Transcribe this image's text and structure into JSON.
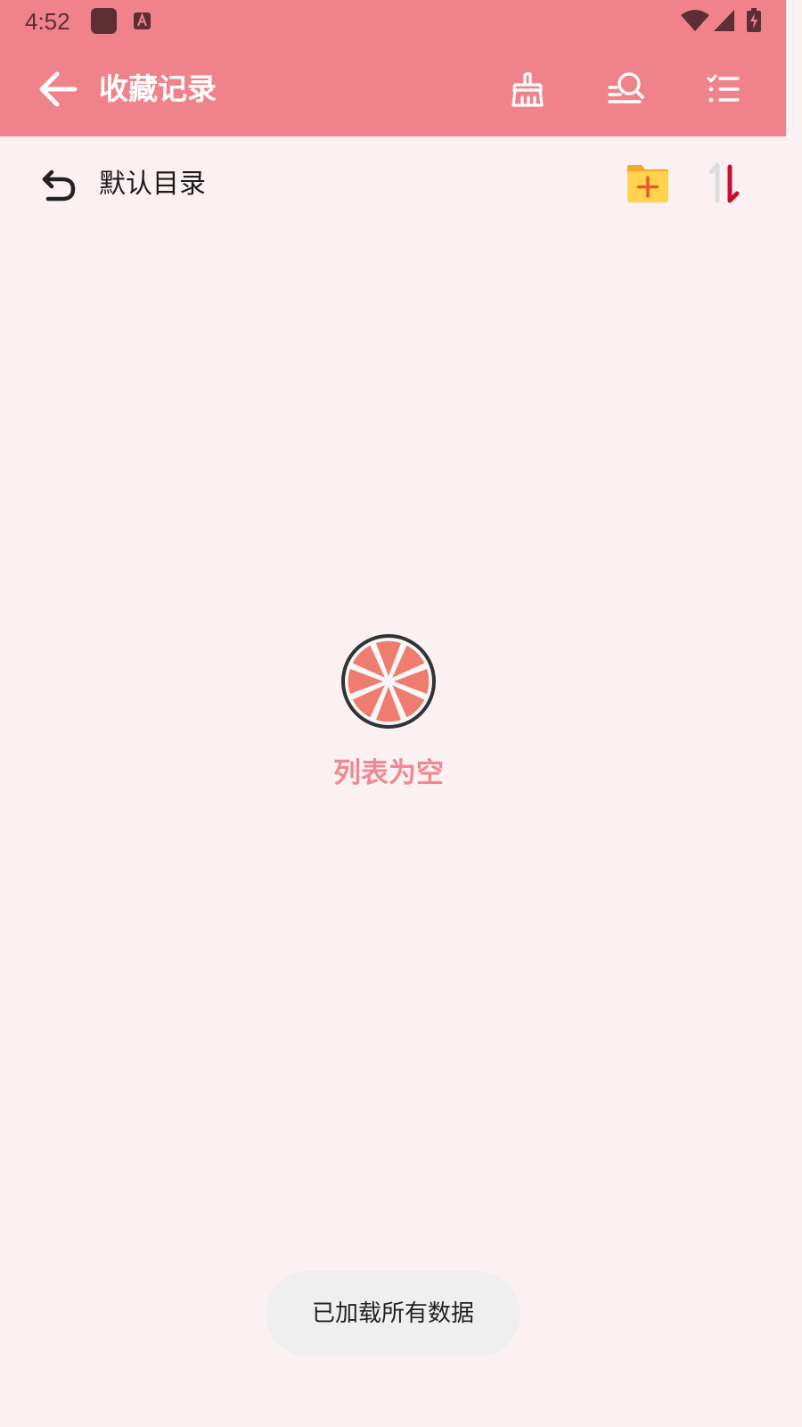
{
  "status_bar": {
    "time": "4:52",
    "icons": [
      "app-icon",
      "a-icon",
      "wifi-icon",
      "signal-icon",
      "battery-icon"
    ]
  },
  "toolbar": {
    "title": "收藏记录",
    "back_icon": "arrow-left-icon",
    "actions": [
      "broom-icon",
      "search-list-icon",
      "checklist-icon"
    ],
    "background": "#f0828b"
  },
  "folder_bar": {
    "back_icon": "undo-icon",
    "name": "默认目录",
    "add_folder_icon": "folder-add-icon",
    "sort_icon": "sort-icon"
  },
  "empty_state": {
    "icon": "grapefruit-icon",
    "text": "列表为空",
    "text_color": "#ee8a93"
  },
  "toast": {
    "text": "已加载所有数据"
  },
  "colors": {
    "page_background": "#fcf1f2",
    "accent": "#f0828b",
    "sort_arrow": "#c8102e",
    "folder_yellow": "#ffd34d"
  }
}
